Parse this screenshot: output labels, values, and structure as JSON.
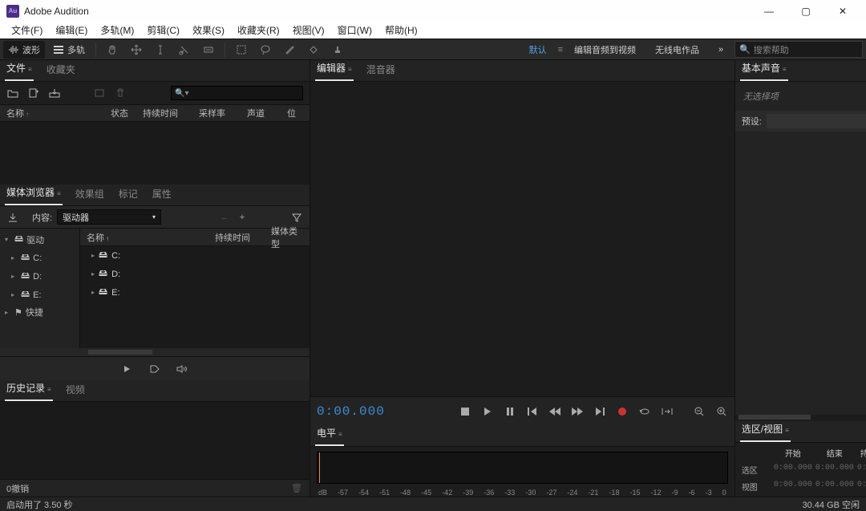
{
  "app": {
    "title": "Adobe Audition",
    "icon_label": "Au"
  },
  "window_controls": {
    "min": "—",
    "max": "▢",
    "close": "✕"
  },
  "menubar": [
    "文件(F)",
    "编辑(E)",
    "多轨(M)",
    "剪辑(C)",
    "效果(S)",
    "收藏夹(R)",
    "视图(V)",
    "窗口(W)",
    "帮助(H)"
  ],
  "toolbar": {
    "waveform": "波形",
    "multitrack": "多轨",
    "workspaces": {
      "default": "默认",
      "edit_audio_to_video": "编辑音频到视频",
      "radio_production": "无线电作品"
    },
    "search_placeholder": "搜索帮助"
  },
  "files_panel": {
    "tabs": [
      "文件",
      "收藏夹"
    ],
    "columns": {
      "name": "名称",
      "status": "状态",
      "duration": "持续时间",
      "sample_rate": "采样率",
      "channels": "声道",
      "bits": "位"
    }
  },
  "media_panel": {
    "tabs": [
      "媒体浏览器",
      "效果组",
      "标记",
      "属性"
    ],
    "content_label": "内容:",
    "content_value": "驱动器",
    "tree": {
      "root": "驱动",
      "d_c": "C:",
      "d_d": "D:",
      "d_e": "E:",
      "shortcuts": "快捷"
    },
    "list": {
      "name_hdr": "名称",
      "duration_hdr": "持续时间",
      "type_hdr": "媒体类型",
      "row_c": "C:",
      "row_d": "D:",
      "row_e": "E:"
    }
  },
  "history_panel": {
    "tabs": [
      "历史记录",
      "视频"
    ],
    "undo_count": "0撤销"
  },
  "editor_panel": {
    "tabs": [
      "编辑器",
      "混音器"
    ],
    "timecode": "0:00.000"
  },
  "levels_panel": {
    "tab": "电平",
    "db_ticks": [
      "dB",
      "-57",
      "-54",
      "-51",
      "-48",
      "-45",
      "-42",
      "-39",
      "-36",
      "-33",
      "-30",
      "-27",
      "-24",
      "-21",
      "-18",
      "-15",
      "-12",
      "-9",
      "-6",
      "-3",
      "0"
    ]
  },
  "essential_panel": {
    "tab": "基本声音",
    "no_selection": "无选择项",
    "preset_label": "预设:"
  },
  "selection_panel": {
    "tab": "选区/视图",
    "headers": {
      "start": "开始",
      "end": "结束",
      "duration": "持续时间"
    },
    "rows": {
      "selection": "选区",
      "view": "视图"
    },
    "zero": "0:00.000"
  },
  "status": {
    "startup": "启动用了 3.50 秒",
    "disk": "30.44 GB 空闲"
  }
}
